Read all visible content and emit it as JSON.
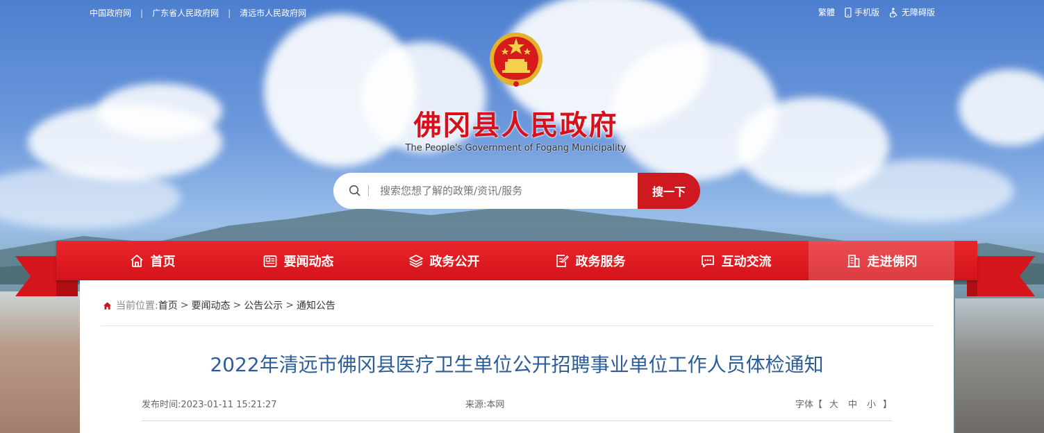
{
  "top_links": [
    "中国政府网",
    "广东省人民政府网",
    "清远市人民政府网"
  ],
  "top_right": {
    "traditional": "繁體",
    "mobile": "手机版",
    "accessible": "无障碍版"
  },
  "site": {
    "title": "佛冈县人民政府",
    "subtitle": "The People's Government of Fogang Municipality"
  },
  "search": {
    "placeholder": "搜索您想了解的政策/资讯/服务",
    "button": "搜一下"
  },
  "nav": [
    {
      "label": "首页",
      "icon": "home-icon"
    },
    {
      "label": "要闻动态",
      "icon": "news-icon"
    },
    {
      "label": "政务公开",
      "icon": "layers-icon"
    },
    {
      "label": "政务服务",
      "icon": "edit-doc-icon"
    },
    {
      "label": "互动交流",
      "icon": "chat-icon"
    },
    {
      "label": "走进佛冈",
      "icon": "building-icon",
      "active": true
    }
  ],
  "breadcrumb": {
    "label": "当前位置:",
    "items": [
      "首页",
      "要闻动态",
      "公告公示",
      "通知公告"
    ]
  },
  "article": {
    "title": "2022年清远市佛冈县医疗卫生单位公开招聘事业单位工作人员体检通知",
    "date_label": "发布时间:",
    "date": "2023-01-11 15:21:27",
    "source_label": "来源:",
    "source": "本网",
    "font_label": "字体【",
    "font_options": [
      "大",
      "中",
      "小"
    ],
    "font_close": "】"
  },
  "colors": {
    "accent_red": "#d41219",
    "title_blue": "#2d5d97"
  }
}
